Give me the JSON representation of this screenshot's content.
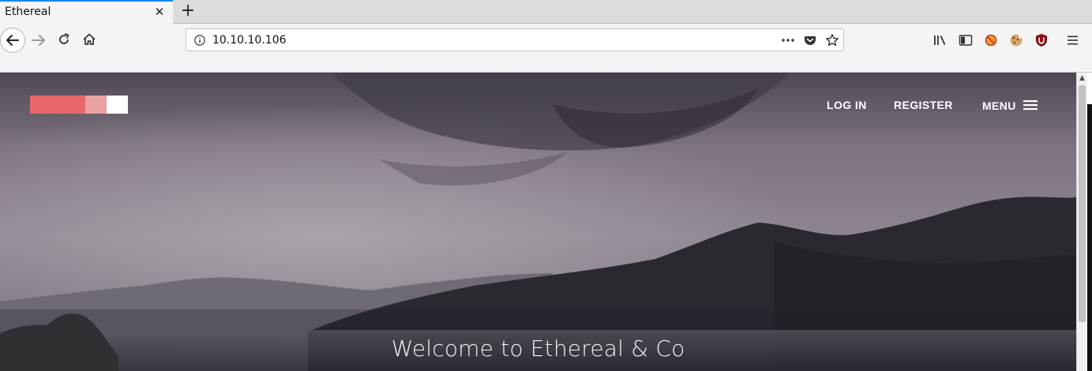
{
  "browser": {
    "tab": {
      "title": "Ethereal",
      "close_label": "✕"
    },
    "new_tab_label": "+",
    "url": "10.10.10.106",
    "accent_color": "#0a84ff"
  },
  "site": {
    "logo_colors": [
      "#e8686a",
      "#eaa1a3",
      "#ffffff"
    ],
    "nav": {
      "login": "LOG IN",
      "register": "REGISTER",
      "menu": "MENU"
    },
    "hero": {
      "title": "Welcome to Ethereal & Co"
    }
  },
  "icons": {
    "back": "arrow-left-icon",
    "forward": "arrow-right-icon",
    "reload": "reload-icon",
    "home": "home-icon",
    "info": "info-icon",
    "page_actions": "more-dots-icon",
    "pocket": "pocket-icon",
    "bookmark": "star-icon",
    "library": "library-icon",
    "sidebar": "sidebar-icon",
    "blocker": "blocked-icon",
    "cookie": "cookie-icon",
    "ublock": "ublock-icon",
    "hamburger": "hamburger-menu-icon"
  }
}
